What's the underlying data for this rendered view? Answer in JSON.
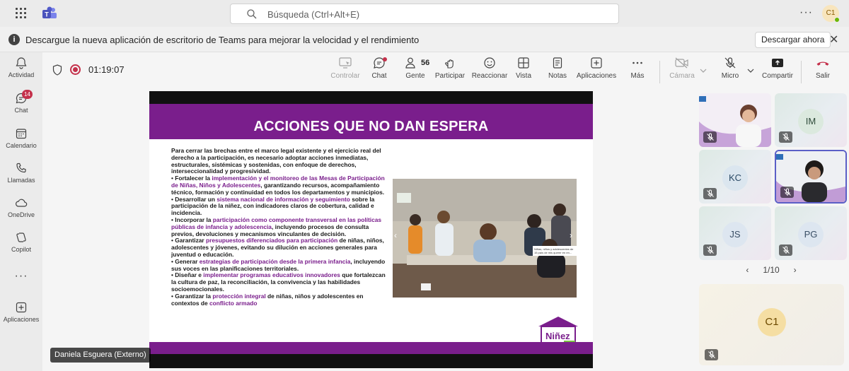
{
  "search": {
    "placeholder": "Búsqueda (Ctrl+Alt+E)"
  },
  "account": {
    "initials": "C1"
  },
  "banner": {
    "message": "Descargue la nueva aplicación de escritorio de Teams para mejorar la velocidad y el rendimiento",
    "download_label": "Descargar ahora"
  },
  "rail": [
    {
      "label": "Actividad",
      "icon": "bell-icon"
    },
    {
      "label": "Chat",
      "icon": "chat-icon",
      "badge": "14"
    },
    {
      "label": "Calendario",
      "icon": "calendar-icon"
    },
    {
      "label": "Llamadas",
      "icon": "phone-icon"
    },
    {
      "label": "OneDrive",
      "icon": "cloud-icon"
    },
    {
      "label": "Copilot",
      "icon": "copilot-icon"
    },
    {
      "label": "···",
      "icon": "more-icon"
    },
    {
      "label": "Aplicaciones",
      "icon": "apps-icon"
    }
  ],
  "meeting": {
    "timer": "01:19:07",
    "participants_count": "56",
    "buttons": {
      "control": "Controlar",
      "chat": "Chat",
      "people": "Gente",
      "raise": "Participar",
      "react": "Reaccionar",
      "view": "Vista",
      "notes": "Notas",
      "apps": "Aplicaciones",
      "more": "Más",
      "camera": "Cámara",
      "mic": "Micro",
      "share": "Compartir",
      "leave": "Salir"
    }
  },
  "slide": {
    "title": "ACCIONES QUE NO DAN ESPERA",
    "intro": "Para cerrar las brechas entre el marco legal existente y el ejercicio real del derecho a la participación, es necesario adoptar acciones inmediatas, estructurales, sistémicas y sostenidas, con enfoque de derechos, interseccionalidad y progresividad.",
    "bullets": [
      {
        "pre": "• Fortalecer la ",
        "hl": "implementación y el monitoreo de las Mesas de Participación de Niñas, Niños y Adolescentes",
        "post": ", garantizando recursos, acompañamiento técnico, formación y continuidad en todos los departamentos y municipios."
      },
      {
        "pre": "• Desarrollar un ",
        "hl": "sistema nacional de información y seguimiento",
        "post": " sobre la participación de la niñez, con indicadores claros de cobertura, calidad e incidencia."
      },
      {
        "pre": "• Incorporar la ",
        "hl": "participación como componente transversal en las políticas públicas de infancia y adolescencia",
        "post": ", incluyendo procesos de consulta previos, devoluciones y mecanismos vinculantes de decisión."
      },
      {
        "pre": "• Garantizar ",
        "hl": "presupuestos diferenciados para participación",
        "post": " de niñas, niños, adolescentes y jóvenes, evitando su dilución en acciones generales para juventud o educación."
      },
      {
        "pre": "• Generar ",
        "hl": "estrategias de participación desde la primera infancia",
        "post": ", incluyendo sus voces en las planificaciones territoriales."
      },
      {
        "pre": "• Diseñar e ",
        "hl": "implementar programas educativos innovadores",
        "post": " que fortalezcan la cultura de paz, la reconciliación, la convivencia y las habilidades socioemocionales."
      },
      {
        "pre": "• Garantizar la ",
        "hl": "protección integral",
        "post": " de niñas, niños y adolescentes en contextos de ",
        "hl2": "conflicto armado"
      }
    ],
    "photo_caption": "Niñas, niños y adolescentes de 15 país de mis querer en en...",
    "logo_text": "Niñez YA"
  },
  "presenter": {
    "name": "Daniela Esguera (Externo)"
  },
  "gallery": {
    "tiles": [
      {
        "type": "video",
        "initials": ""
      },
      {
        "type": "initials",
        "initials": "IM"
      },
      {
        "type": "initials",
        "initials": "KC"
      },
      {
        "type": "video",
        "initials": ""
      },
      {
        "type": "initials",
        "initials": "JS"
      },
      {
        "type": "initials",
        "initials": "PG"
      }
    ],
    "pager": "1/10",
    "self_initials": "C1"
  },
  "colors": {
    "accent": "#5b5fc7",
    "slide_purple": "#7a1e8c",
    "leave_red": "#c4314b",
    "badge_red": "#c4314b"
  }
}
